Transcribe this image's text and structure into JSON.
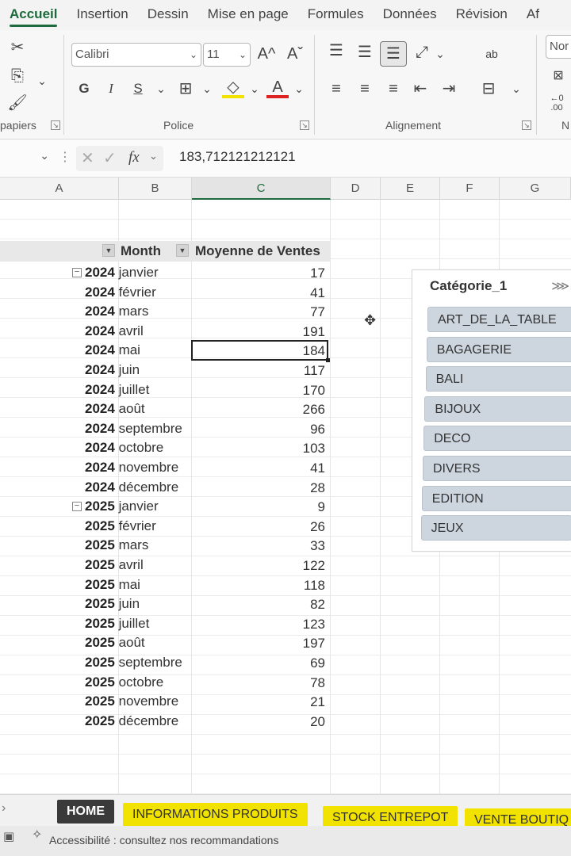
{
  "ribbon": {
    "tabs": [
      "Accueil",
      "Insertion",
      "Dessin",
      "Mise en page",
      "Formules",
      "Données",
      "Révision",
      "Af"
    ],
    "groups": {
      "clipboard": "papiers",
      "font": "Police",
      "alignment": "Alignement",
      "number": "N"
    },
    "font_name": "Calibri",
    "font_size": "11",
    "bold": "G",
    "italic": "I",
    "underline": "S",
    "number_format": "Nor",
    "grow_font": "A^",
    "shrink_font": "Aˇ",
    "font_color": "A",
    "wrap": "ab",
    "decimal": "←0\n.00"
  },
  "formula_bar": {
    "fx_label": "fx",
    "value": "183,712121212121"
  },
  "columns": [
    "A",
    "B",
    "C",
    "D",
    "E",
    "F",
    "G"
  ],
  "pivot": {
    "row_header": "Month",
    "value_header": "Moyenne de Ventes",
    "rows": [
      {
        "year": "2024",
        "month": "janvier",
        "value": "17",
        "group_start": true
      },
      {
        "year": "2024",
        "month": "février",
        "value": "41"
      },
      {
        "year": "2024",
        "month": "mars",
        "value": "77"
      },
      {
        "year": "2024",
        "month": "avril",
        "value": "191"
      },
      {
        "year": "2024",
        "month": "mai",
        "value": "184",
        "active": true
      },
      {
        "year": "2024",
        "month": "juin",
        "value": "117"
      },
      {
        "year": "2024",
        "month": "juillet",
        "value": "170"
      },
      {
        "year": "2024",
        "month": "août",
        "value": "266"
      },
      {
        "year": "2024",
        "month": "septembre",
        "value": "96"
      },
      {
        "year": "2024",
        "month": "octobre",
        "value": "103"
      },
      {
        "year": "2024",
        "month": "novembre",
        "value": "41"
      },
      {
        "year": "2024",
        "month": "décembre",
        "value": "28"
      },
      {
        "year": "2025",
        "month": "janvier",
        "value": "9",
        "group_start": true
      },
      {
        "year": "2025",
        "month": "février",
        "value": "26"
      },
      {
        "year": "2025",
        "month": "mars",
        "value": "33"
      },
      {
        "year": "2025",
        "month": "avril",
        "value": "122"
      },
      {
        "year": "2025",
        "month": "mai",
        "value": "118"
      },
      {
        "year": "2025",
        "month": "juin",
        "value": "82"
      },
      {
        "year": "2025",
        "month": "juillet",
        "value": "123"
      },
      {
        "year": "2025",
        "month": "août",
        "value": "197"
      },
      {
        "year": "2025",
        "month": "septembre",
        "value": "69"
      },
      {
        "year": "2025",
        "month": "octobre",
        "value": "78"
      },
      {
        "year": "2025",
        "month": "novembre",
        "value": "21"
      },
      {
        "year": "2025",
        "month": "décembre",
        "value": "20"
      }
    ]
  },
  "slicer": {
    "title": "Catégorie_1",
    "items": [
      "ART_DE_LA_TABLE",
      "BAGAGERIE",
      "BALI",
      "BIJOUX",
      "DECO",
      "DIVERS",
      "EDITION",
      "JEUX"
    ]
  },
  "sheet_tabs": [
    "HOME",
    "INFORMATIONS PRODUITS",
    "STOCK ENTREPOT",
    "VENTE BOUTIQ"
  ],
  "status": {
    "accessibility": "Accessibilité : consultez nos recommandations"
  },
  "colors": {
    "accent": "#1d6b3c",
    "slicer_item": "#cdd5df",
    "tab_yellow": "#f2e200",
    "tab_home": "#3a3a3a"
  }
}
